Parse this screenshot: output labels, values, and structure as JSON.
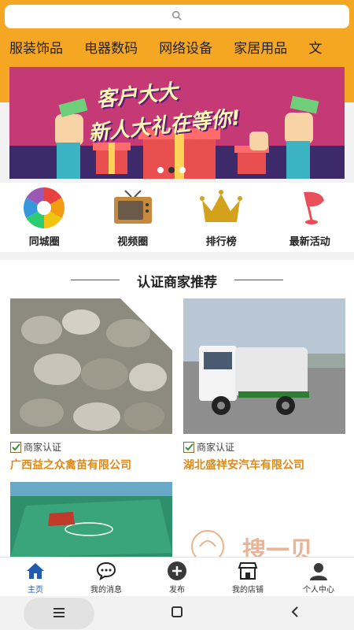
{
  "search": {
    "icon": "search-icon"
  },
  "categories": [
    "服装饰品",
    "电器数码",
    "网络设备",
    "家居用品",
    "文"
  ],
  "banner": {
    "line1": "客户大大",
    "line2": "新人大礼在等你!",
    "slide_count": 3,
    "active_slide": 2
  },
  "quick_links": [
    {
      "label": "同城圈",
      "icon": "aperture-icon"
    },
    {
      "label": "视频圈",
      "icon": "tv-icon"
    },
    {
      "label": "排行榜",
      "icon": "crown-icon"
    },
    {
      "label": "最新活动",
      "icon": "flag-icon"
    }
  ],
  "section": {
    "title": "认证商家推荐"
  },
  "merchants": [
    {
      "badge": "商家认证",
      "name": "广西益之众禽苗有限公司"
    },
    {
      "badge": "商家认证",
      "name": "湖北盛祥安汽车有限公司"
    }
  ],
  "watermark": "搜一贝",
  "tabbar": [
    {
      "label": "主页",
      "icon": "home-icon",
      "active": true
    },
    {
      "label": "我的消息",
      "icon": "chat-icon",
      "active": false
    },
    {
      "label": "发布",
      "icon": "plus-circle-icon",
      "active": false
    },
    {
      "label": "我的店铺",
      "icon": "store-icon",
      "active": false
    },
    {
      "label": "个人中心",
      "icon": "user-icon",
      "active": false
    }
  ],
  "colors": {
    "accent": "#f5a623",
    "merchant_name": "#e08a16",
    "active_tab": "#1f5bb3"
  }
}
